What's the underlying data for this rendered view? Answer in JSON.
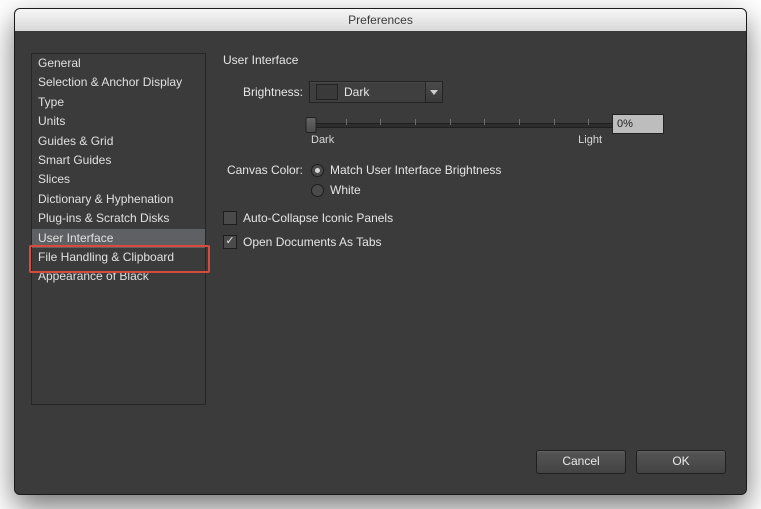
{
  "window": {
    "title": "Preferences"
  },
  "sidebar": {
    "items": [
      "General",
      "Selection & Anchor Display",
      "Type",
      "Units",
      "Guides & Grid",
      "Smart Guides",
      "Slices",
      "Dictionary & Hyphenation",
      "Plug-ins & Scratch Disks",
      "User Interface",
      "File Handling & Clipboard",
      "Appearance of Black"
    ],
    "selected_index": 9
  },
  "main": {
    "title": "User Interface",
    "brightness": {
      "label": "Brightness:",
      "value": "Dark",
      "percent": "0%",
      "slider_min": "Dark",
      "slider_max": "Light",
      "slider_position": 0
    },
    "canvas": {
      "label": "Canvas Color:",
      "options": [
        "Match User Interface Brightness",
        "White"
      ],
      "selected_index": 0
    },
    "checks": [
      {
        "label": "Auto-Collapse Iconic Panels",
        "checked": false
      },
      {
        "label": "Open Documents As Tabs",
        "checked": true
      }
    ]
  },
  "buttons": {
    "cancel": "Cancel",
    "ok": "OK"
  }
}
